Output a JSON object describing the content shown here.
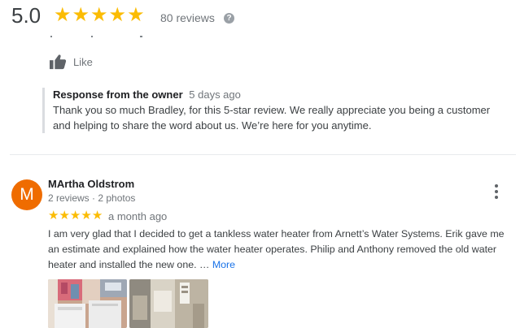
{
  "header": {
    "rating": "5.0",
    "stars": 5,
    "reviews_count": "80 reviews",
    "help_glyph": "?"
  },
  "prev_review": {
    "like_label": "Like",
    "owner_response": {
      "title": "Response from the owner",
      "time": "5 days ago",
      "text": "Thank you so much Bradley, for this 5-star review. We really appreciate you being a customer and helping to share the word about us. We’re here for you anytime."
    }
  },
  "review": {
    "avatar_letter": "M",
    "reviewer": "MArtha Oldstrom",
    "meta": "2 reviews · 2 photos",
    "stars": 5,
    "time": "a month ago",
    "text": "I am very glad that I decided to get a tankless water heater from Arnett’s Water Systems.  Erik gave me an estimate and explained how the water heater operates. Philip and Anthony removed the old water heater and installed the new one. …",
    "more_label": "More",
    "photos": [
      "laundry-room-photo",
      "water-heater-photo"
    ]
  },
  "colors": {
    "star": "#fbbc04",
    "avatar": "#ef6c00",
    "link": "#1a73e8",
    "muted_text": "#70757a"
  },
  "icons": [
    "star-icon",
    "help-icon",
    "thumbs-up-icon",
    "more-vert-icon"
  ]
}
